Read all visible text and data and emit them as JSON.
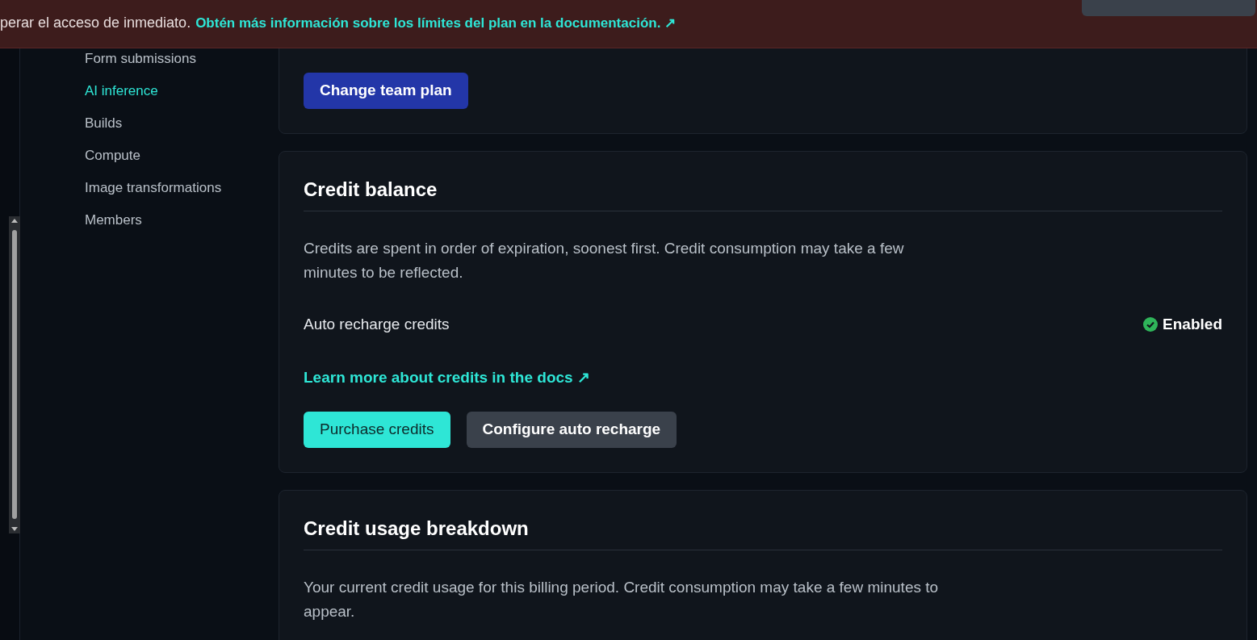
{
  "banner": {
    "line_2": "perar el acceso de inmediato.",
    "link": "Obtén más información sobre los límites del plan en la documentación.",
    "link_icon": "↗"
  },
  "sidebar": {
    "items": [
      {
        "label": "Form submissions",
        "selected": false
      },
      {
        "label": "AI inference",
        "selected": true
      },
      {
        "label": "Builds",
        "selected": false
      },
      {
        "label": "Compute",
        "selected": false
      },
      {
        "label": "Image transformations",
        "selected": false
      },
      {
        "label": "Members",
        "selected": false
      }
    ]
  },
  "plan_card": {
    "button": "Change team plan"
  },
  "credit_balance": {
    "title": "Credit balance",
    "description": "Credits are spent in order of expiration, soonest first. Credit consumption may take a few minutes to be reflected.",
    "setting_label": "Auto recharge credits",
    "enabled": true,
    "status": "Enabled",
    "link": "Learn more about credits in the docs",
    "link_icon": "↗",
    "buttons": [
      {
        "label": "Purchase credits",
        "kind": "primary"
      },
      {
        "label": "Configure auto recharge",
        "kind": "secondary"
      }
    ]
  },
  "credit_usage": {
    "title": "Credit usage breakdown",
    "description": "Your current credit usage for this billing period. Credit consumption may take a few minutes to appear."
  }
}
